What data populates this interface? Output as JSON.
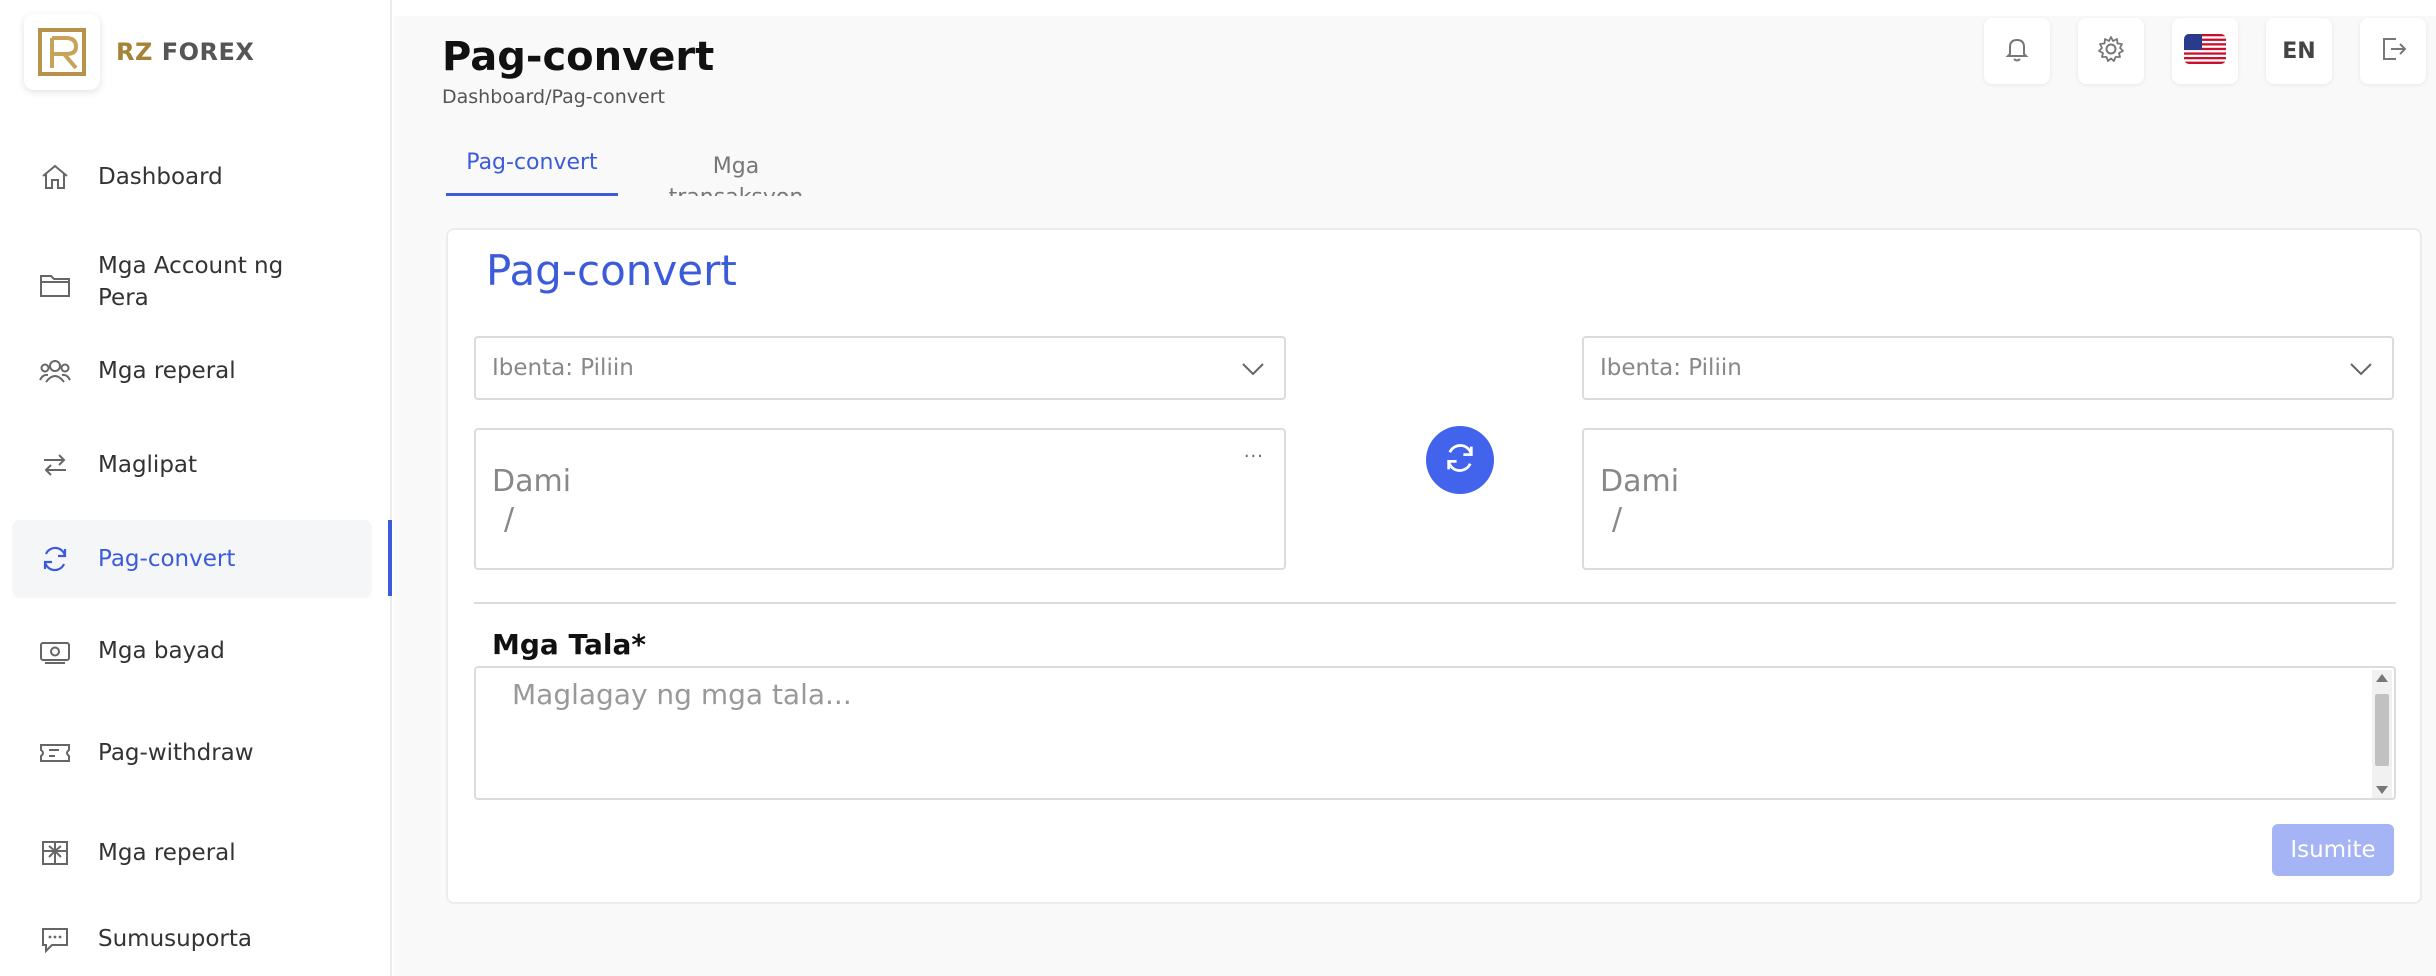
{
  "brand": {
    "prefix": "RZ",
    "name": "FOREX"
  },
  "sidebar": {
    "items": [
      {
        "label": "Dashboard",
        "icon": "home-icon"
      },
      {
        "label": "Mga Account ng Pera",
        "icon": "folder-icon"
      },
      {
        "label": "Mga reperal",
        "icon": "users-icon"
      },
      {
        "label": "Maglipat",
        "icon": "transfer-icon"
      },
      {
        "label": "Pag-convert",
        "icon": "refresh-icon",
        "active": true
      },
      {
        "label": "Mga bayad",
        "icon": "cash-icon"
      },
      {
        "label": "Pag-withdraw",
        "icon": "ticket-icon"
      },
      {
        "label": "Mga reperal",
        "icon": "gift-icon"
      },
      {
        "label": "Sumusuporta",
        "icon": "chat-icon"
      }
    ]
  },
  "header": {
    "title": "Pag-convert",
    "breadcrumb": "Dashboard/Pag-convert",
    "language": "EN"
  },
  "tabs": [
    {
      "label": "Pag-convert",
      "active": true
    },
    {
      "label": "Mga transaksyon",
      "active": false
    }
  ],
  "form": {
    "title": "Pag-convert",
    "sell_left": {
      "label": "Ibenta:",
      "value": "Piliin"
    },
    "sell_right": {
      "label": "Ibenta:",
      "value": "Piliin"
    },
    "amount_left": {
      "label": "Dami",
      "sub": "/",
      "more": "···"
    },
    "amount_right": {
      "label": "Dami",
      "sub": "/"
    },
    "notes_label": "Mga Tala*",
    "notes_placeholder": "Maglagay ng mga tala...",
    "submit_label": "Isumite"
  },
  "colors": {
    "accent": "#3b5bdb",
    "swap_button": "#4263eb",
    "submit_disabled": "#a5b4f5",
    "brand_gold": "#a58238"
  }
}
